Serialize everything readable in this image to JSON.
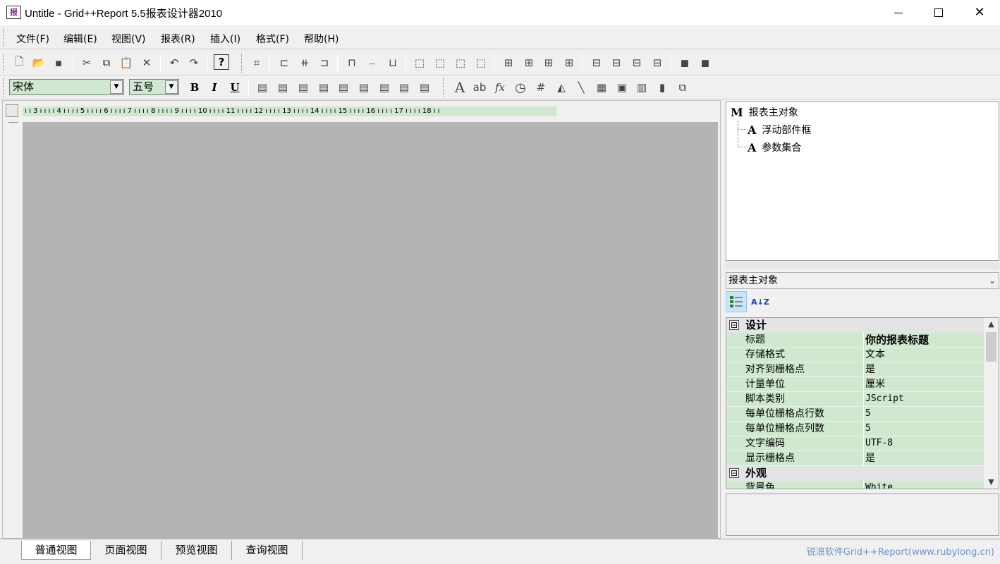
{
  "window": {
    "title": "Untitle - Grid++Report 5.5报表设计器2010",
    "app_icon_glyph": "报",
    "minimize_icon": "minimize-icon",
    "maximize_icon": "maximize-icon",
    "close_glyph": "✕"
  },
  "menu": [
    {
      "label": "文件(F)"
    },
    {
      "label": "编辑(E)"
    },
    {
      "label": "视图(V)"
    },
    {
      "label": "报表(R)"
    },
    {
      "label": "插入(I)"
    },
    {
      "label": "格式(F)"
    },
    {
      "label": "帮助(H)"
    }
  ],
  "toolbar1": [
    {
      "name": "new-file-icon",
      "glyph": "🗋"
    },
    {
      "name": "open-folder-icon",
      "glyph": "📂"
    },
    {
      "name": "save-icon",
      "glyph": "▪"
    },
    {
      "name": "cut-icon",
      "glyph": "✂"
    },
    {
      "name": "copy-icon",
      "glyph": "⧉"
    },
    {
      "name": "paste-icon",
      "glyph": "📋"
    },
    {
      "name": "delete-icon",
      "glyph": "✕"
    },
    {
      "name": "undo-icon",
      "glyph": "↶"
    },
    {
      "name": "redo-icon",
      "glyph": "↷"
    },
    {
      "name": "help-icon",
      "glyph": "?"
    },
    {
      "name": "bring-to-grid-icon",
      "glyph": "⌗"
    },
    {
      "name": "align-left-icon",
      "glyph": "⊏"
    },
    {
      "name": "align-center-icon",
      "glyph": "⧺"
    },
    {
      "name": "align-right-icon",
      "glyph": "⊐"
    },
    {
      "name": "align-top-icon",
      "glyph": "⊓"
    },
    {
      "name": "align-middle-icon",
      "glyph": "⧿"
    },
    {
      "name": "align-bottom-icon",
      "glyph": "⊔"
    },
    {
      "name": "same-width-icon",
      "glyph": "⬚"
    },
    {
      "name": "same-height-icon",
      "glyph": "⬚"
    },
    {
      "name": "same-size-icon",
      "glyph": "⬚"
    },
    {
      "name": "size-to-grid-icon",
      "glyph": "⬚"
    },
    {
      "name": "hspace-equal-icon",
      "glyph": "⊞"
    },
    {
      "name": "hspace-increase-icon",
      "glyph": "⊞"
    },
    {
      "name": "hspace-decrease-icon",
      "glyph": "⊞"
    },
    {
      "name": "hspace-remove-icon",
      "glyph": "⊞"
    },
    {
      "name": "vspace-equal-icon",
      "glyph": "⊟"
    },
    {
      "name": "vspace-increase-icon",
      "glyph": "⊟"
    },
    {
      "name": "vspace-decrease-icon",
      "glyph": "⊟"
    },
    {
      "name": "vspace-remove-icon",
      "glyph": "⊟"
    },
    {
      "name": "bring-to-front-icon",
      "glyph": "◼"
    },
    {
      "name": "send-to-back-icon",
      "glyph": "◼"
    }
  ],
  "format_bar": {
    "font_name": "宋体",
    "font_size": "五号",
    "combo_arrow": "▼",
    "bold": "B",
    "italic": "I",
    "underline": "U"
  },
  "toolbar2": [
    {
      "name": "text-align-top-left-icon",
      "glyph": "▤"
    },
    {
      "name": "text-align-middle-left-icon",
      "glyph": "▤"
    },
    {
      "name": "text-align-bottom-left-icon",
      "glyph": "▤"
    },
    {
      "name": "text-align-top-center-icon",
      "glyph": "▤"
    },
    {
      "name": "text-align-middle-center-icon",
      "glyph": "▤"
    },
    {
      "name": "text-align-bottom-center-icon",
      "glyph": "▤"
    },
    {
      "name": "text-align-top-right-icon",
      "glyph": "▤"
    },
    {
      "name": "text-align-middle-right-icon",
      "glyph": "▤"
    },
    {
      "name": "text-align-bottom-right-icon",
      "glyph": "▤"
    },
    {
      "name": "static-text-icon",
      "glyph": "A"
    },
    {
      "name": "field-box-icon",
      "glyph": "ab"
    },
    {
      "name": "formula-icon",
      "glyph": "fx"
    },
    {
      "name": "datetime-icon",
      "glyph": "◷"
    },
    {
      "name": "page-number-icon",
      "glyph": "#"
    },
    {
      "name": "shape-icon",
      "glyph": "◭"
    },
    {
      "name": "line-icon",
      "glyph": "╲"
    },
    {
      "name": "rich-text-icon",
      "glyph": "▦"
    },
    {
      "name": "picture-icon",
      "glyph": "▣"
    },
    {
      "name": "chart-icon",
      "glyph": "▥"
    },
    {
      "name": "barcode-icon",
      "glyph": "▮"
    },
    {
      "name": "sub-report-icon",
      "glyph": "⧉"
    }
  ],
  "ruler": {
    "labels": [
      "3",
      "4",
      "5",
      "6",
      "7",
      "8",
      "9",
      "10",
      "11",
      "12",
      "13",
      "14",
      "15",
      "16",
      "17",
      "18"
    ]
  },
  "tree": {
    "root": {
      "icon": "M",
      "label": "报表主对象"
    },
    "children": [
      {
        "icon": "A",
        "label": "浮动部件框"
      },
      {
        "icon": "A",
        "label": "参数集合"
      }
    ]
  },
  "properties": {
    "selected_object": "报表主对象",
    "dropdown_arrow": "⌄",
    "categorized_icon": "categorized-view-icon",
    "alphabetical_icon": "alphabetical-sort-icon",
    "alphabetical_glyph": "A↓Z",
    "sections": [
      {
        "label": "设计",
        "toggle": "⊟",
        "rows": [
          {
            "name": "标题",
            "value": "你的报表标题",
            "style": "strong"
          },
          {
            "name": "存储格式",
            "value": "文本",
            "style": "cjk"
          },
          {
            "name": "对齐到栅格点",
            "value": "是",
            "style": "cjk"
          },
          {
            "name": "计量单位",
            "value": "厘米",
            "style": "cjk"
          },
          {
            "name": "脚本类别",
            "value": "JScript",
            "style": "mono"
          },
          {
            "name": "每单位栅格点行数",
            "value": "5",
            "style": "mono"
          },
          {
            "name": "每单位栅格点列数",
            "value": "5",
            "style": "mono"
          },
          {
            "name": "文字编码",
            "value": "UTF-8",
            "style": "mono"
          },
          {
            "name": "显示栅格点",
            "value": "是",
            "style": "cjk"
          }
        ]
      },
      {
        "label": "外观",
        "toggle": "⊟",
        "rows": [
          {
            "name": "背景色",
            "value": "White",
            "style": "mono"
          }
        ]
      }
    ],
    "scroll_up": "▲",
    "scroll_down": "▼"
  },
  "view_tabs": [
    {
      "label": "普通视图",
      "active": true
    },
    {
      "label": "页面视图",
      "active": false
    },
    {
      "label": "预览视图",
      "active": false
    },
    {
      "label": "查询视图",
      "active": false
    }
  ],
  "status": {
    "brand_text": "锐浪软件Grid++Report(www.rubylong.cn)"
  }
}
